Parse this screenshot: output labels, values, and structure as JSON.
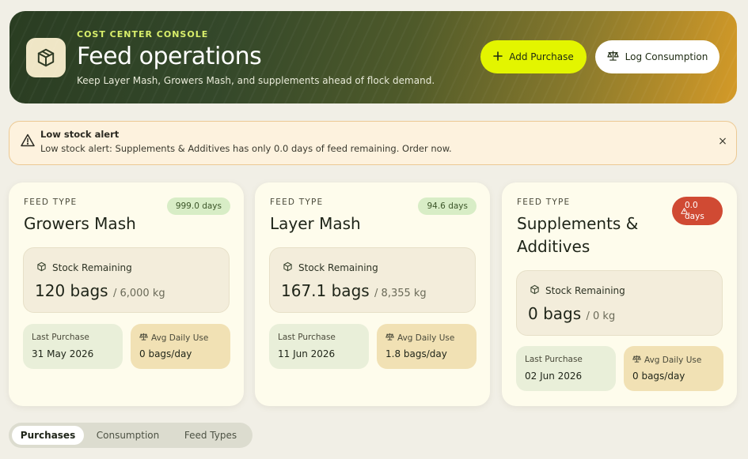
{
  "header": {
    "eyebrow": "COST CENTER CONSOLE",
    "title": "Feed operations",
    "subtitle": "Keep Layer Mash, Growers Mash, and supplements ahead of flock demand.",
    "icon": "package-icon",
    "add_purchase_label": "Add Purchase",
    "log_consumption_label": "Log Consumption"
  },
  "alert": {
    "title": "Low stock alert",
    "message": "Low stock alert: Supplements & Additives has only 0.0 days of feed remaining. Order now.",
    "close": "×"
  },
  "cards": [
    {
      "eyebrow": "FEED TYPE",
      "title": "Growers Mash",
      "days_badge": "999.0 days",
      "stock_label": "Stock Remaining",
      "stock_value": "120 bags",
      "stock_unit": "/ 6,000 kg",
      "last_purchase_label": "Last Purchase",
      "last_purchase_value": "31 May 2026",
      "avg_daily_label": "Avg Daily Use",
      "avg_daily_value": "0 bags/day"
    },
    {
      "eyebrow": "FEED TYPE",
      "title": "Layer Mash",
      "days_badge": "94.6 days",
      "stock_label": "Stock Remaining",
      "stock_value": "167.1 bags",
      "stock_unit": "/ 8,355 kg",
      "last_purchase_label": "Last Purchase",
      "last_purchase_value": "11 Jun 2026",
      "avg_daily_label": "Avg Daily Use",
      "avg_daily_value": "1.8 bags/day"
    },
    {
      "eyebrow": "FEED TYPE",
      "title": "Supplements & Additives",
      "days_badge_line1": "0.0",
      "days_badge_line2": "days",
      "stock_label": "Stock Remaining",
      "stock_value": "0 bags",
      "stock_unit": "/ 0 kg",
      "last_purchase_label": "Last Purchase",
      "last_purchase_value": "02 Jun 2026",
      "avg_daily_label": "Avg Daily Use",
      "avg_daily_value": "0 bags/day"
    }
  ],
  "tabs": [
    {
      "label": "Purchases",
      "active": true
    },
    {
      "label": "Consumption",
      "active": false
    },
    {
      "label": "Feed Types",
      "active": false
    }
  ],
  "colors": {
    "accent": "#e3f500",
    "alert_bg": "#fdf2de",
    "danger": "#d04a33",
    "ok_badge": "#d8edc6"
  }
}
